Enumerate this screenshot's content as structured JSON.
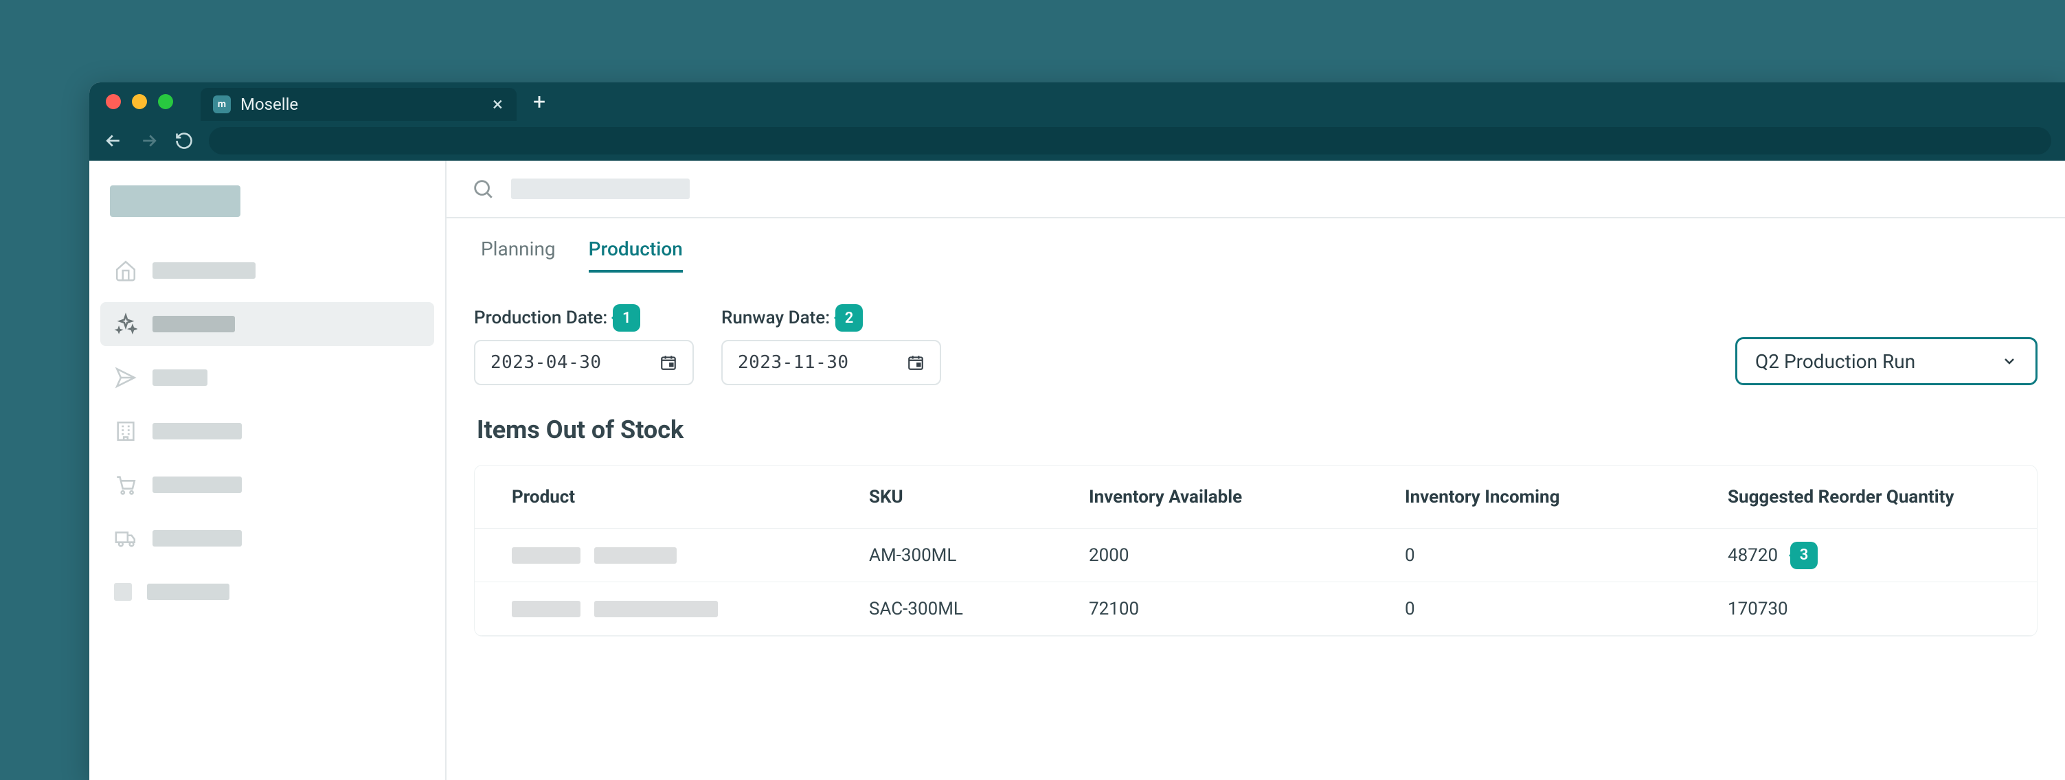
{
  "browser": {
    "tab_title": "Moselle",
    "favicon_letter": "m"
  },
  "tabs": {
    "planning": "Planning",
    "production": "Production"
  },
  "filters": {
    "production_label": "Production Date:",
    "production_value": "2023-04-30",
    "runway_label": "Runway Date:",
    "runway_value": "2023-11-30",
    "run_selected": "Q2 Production Run"
  },
  "callouts": {
    "c1": "1",
    "c2": "2",
    "c3": "3"
  },
  "section": {
    "title": "Items Out of Stock"
  },
  "table": {
    "headers": {
      "product": "Product",
      "sku": "SKU",
      "available": "Inventory Available",
      "incoming": "Inventory Incoming",
      "reorder": "Suggested Reorder Quantity"
    },
    "rows": [
      {
        "sku": "AM-300ML",
        "available": "2000",
        "incoming": "0",
        "reorder": "48720"
      },
      {
        "sku": "SAC-300ML",
        "available": "72100",
        "incoming": "0",
        "reorder": "170730"
      }
    ]
  }
}
